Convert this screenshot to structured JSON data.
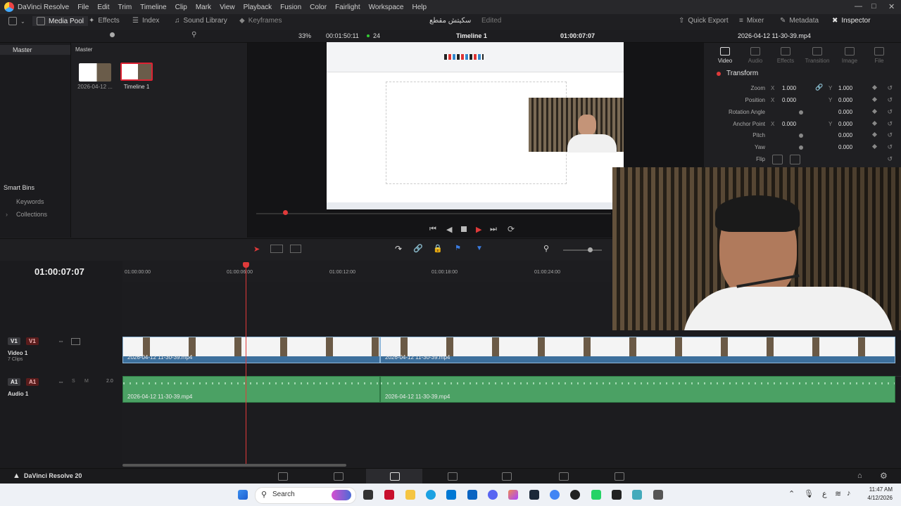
{
  "app": {
    "title": "DaVinci Resolve",
    "menu": [
      "File",
      "Edit",
      "Trim",
      "Timeline",
      "Clip",
      "Mark",
      "View",
      "Playback",
      "Fusion",
      "Color",
      "Fairlight",
      "Workspace",
      "Help"
    ],
    "project_name": "سكيتش مقطع",
    "project_status": "Edited",
    "version_label": "DaVinci Resolve 20"
  },
  "toolbar": {
    "media_pool": "Media Pool",
    "effects": "Effects",
    "index": "Index",
    "sound_library": "Sound Library",
    "keyframes": "Keyframes",
    "quick_export": "Quick Export",
    "mixer": "Mixer",
    "metadata": "Metadata",
    "inspector": "Inspector"
  },
  "viewer_bar": {
    "zoom": "33%",
    "duration": "00:01:50:11",
    "fps": "24",
    "timeline_name": "Timeline 1",
    "timecode": "01:00:07:07",
    "clip_name": "2026-04-12 11-30-39.mp4"
  },
  "media_pool": {
    "bin_root": "Master",
    "breadcrumb": "Master",
    "smart_bins": "Smart Bins",
    "keywords": "Keywords",
    "collections": "Collections",
    "items": [
      {
        "label": "2026-04-12 ...",
        "selected": false
      },
      {
        "label": "Timeline 1",
        "selected": true
      }
    ]
  },
  "inspector": {
    "tabs": [
      "Video",
      "Audio",
      "Effects",
      "Transition",
      "Image",
      "File"
    ],
    "active_tab": "Video",
    "section": "Transform",
    "rows": [
      {
        "label": "Zoom",
        "x": "1.000",
        "y": "1.000"
      },
      {
        "label": "Position",
        "x": "0.000",
        "y": "0.000"
      },
      {
        "label": "Rotation Angle",
        "value": "0.000"
      },
      {
        "label": "Anchor Point",
        "x": "0.000",
        "y": "0.000"
      },
      {
        "label": "Pitch",
        "value": "0.000"
      },
      {
        "label": "Yaw",
        "value": "0.000"
      },
      {
        "label": "Flip"
      }
    ],
    "x_label": "X",
    "y_label": "Y"
  },
  "timeline": {
    "timecode": "01:00:07:07",
    "ruler": [
      "01:00:00:00",
      "01:00:06:00",
      "01:00:12:00",
      "01:00:18:00",
      "01:00:24:00"
    ],
    "video_track": {
      "id": "V1",
      "name": "Video 1",
      "clips_count": "7 Clips"
    },
    "audio_track": {
      "id": "A1",
      "name": "Audio 1",
      "level": "2.0",
      "solo": "S",
      "mute": "M"
    },
    "clips": [
      {
        "label": "2026-04-12 11-30-39.mp4"
      },
      {
        "label": "2026-04-12 11-30-39.mp4"
      }
    ]
  },
  "taskbar": {
    "search": "Search",
    "time": "11:47 AM",
    "date": "4/12/2026",
    "lang": "ع"
  },
  "colors": {
    "accent_red": "#e03a3a",
    "video_clip": "#3c6f9c",
    "audio_clip": "#4ba164"
  }
}
